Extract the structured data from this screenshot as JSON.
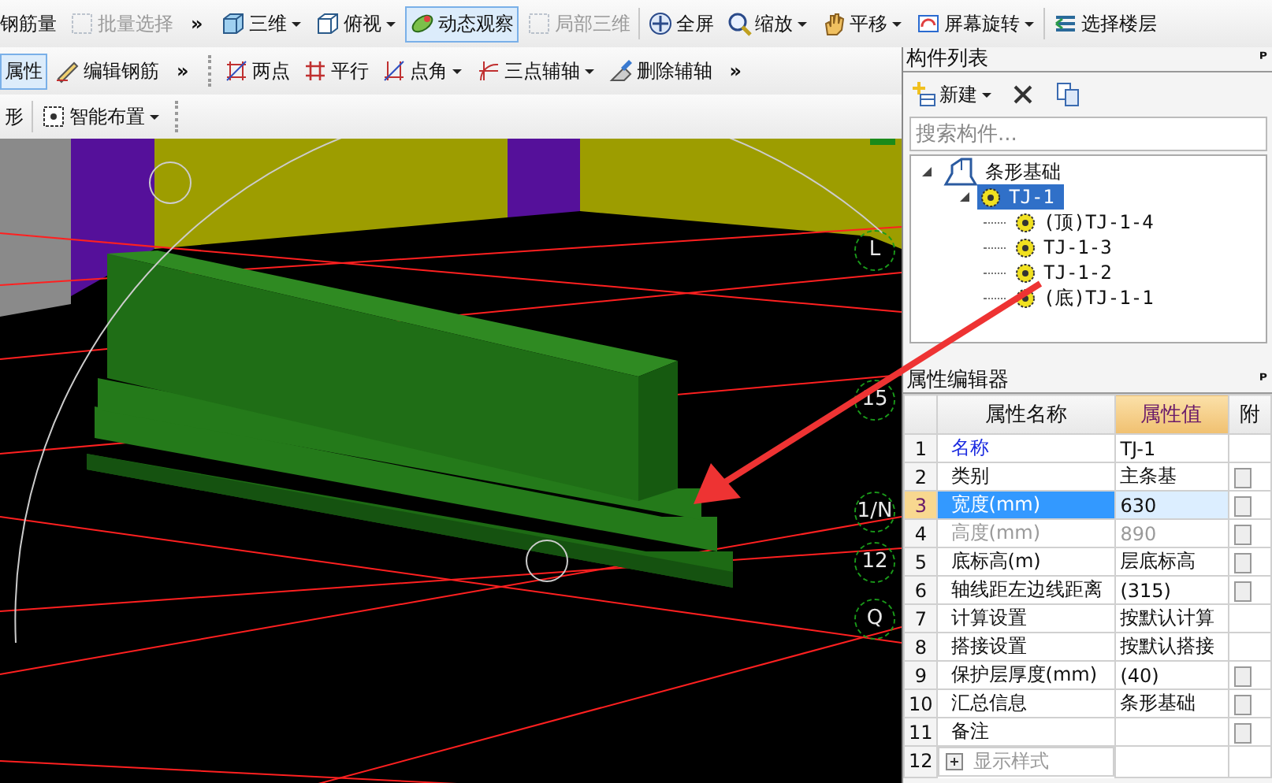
{
  "toolbar_1": [
    {
      "label": "钢筋量",
      "kind": "button",
      "selected": false,
      "disabled": false,
      "dropdown": false
    },
    {
      "label": "批量选择",
      "kind": "button",
      "selected": false,
      "disabled": true,
      "dropdown": false
    },
    {
      "label": "»",
      "kind": "overflow"
    },
    {
      "label": "三维",
      "kind": "button",
      "selected": false,
      "disabled": false,
      "dropdown": true
    },
    {
      "label": "俯视",
      "kind": "button",
      "selected": false,
      "disabled": false,
      "dropdown": true
    },
    {
      "label": "动态观察",
      "kind": "button",
      "selected": true,
      "disabled": false,
      "dropdown": false
    },
    {
      "label": "局部三维",
      "kind": "button",
      "selected": false,
      "disabled": true,
      "dropdown": false
    },
    {
      "kind": "separator"
    },
    {
      "label": "全屏",
      "kind": "button",
      "selected": false,
      "disabled": false,
      "dropdown": false
    },
    {
      "label": "缩放",
      "kind": "button",
      "selected": false,
      "disabled": false,
      "dropdown": true
    },
    {
      "label": "平移",
      "kind": "button",
      "selected": false,
      "disabled": false,
      "dropdown": true
    },
    {
      "label": "屏幕旋转",
      "kind": "button",
      "selected": false,
      "disabled": false,
      "dropdown": true
    },
    {
      "kind": "separator"
    },
    {
      "label": "选择楼层",
      "kind": "button",
      "selected": false,
      "disabled": false,
      "dropdown": false
    }
  ],
  "toolbar_2": [
    {
      "label": "属性",
      "kind": "button",
      "selected": true,
      "disabled": false,
      "dropdown": false
    },
    {
      "label": "编辑钢筋",
      "kind": "button",
      "selected": false,
      "disabled": false,
      "dropdown": false
    },
    {
      "label": "»",
      "kind": "overflow"
    },
    {
      "kind": "handle"
    },
    {
      "label": "两点",
      "kind": "button",
      "selected": false,
      "disabled": false,
      "dropdown": false
    },
    {
      "label": "平行",
      "kind": "button",
      "selected": false,
      "disabled": false,
      "dropdown": false
    },
    {
      "label": "点角",
      "kind": "button",
      "selected": false,
      "disabled": false,
      "dropdown": true
    },
    {
      "label": "三点辅轴",
      "kind": "button",
      "selected": false,
      "disabled": false,
      "dropdown": true
    },
    {
      "label": "删除辅轴",
      "kind": "button",
      "selected": false,
      "disabled": false,
      "dropdown": false
    },
    {
      "label": "»",
      "kind": "overflow"
    }
  ],
  "toolbar_3": [
    {
      "label": "形",
      "kind": "button",
      "selected": false,
      "disabled": false,
      "dropdown": false
    },
    {
      "kind": "separator"
    },
    {
      "label": "智能布置",
      "kind": "button",
      "selected": false,
      "disabled": false,
      "dropdown": true
    },
    {
      "kind": "handle"
    }
  ],
  "viewport": {
    "axis_labels": [
      "L",
      "15",
      "1/N",
      "12",
      "Q"
    ]
  },
  "component_list": {
    "title": "构件列表",
    "pin": "ᴾ",
    "new_button": {
      "label": "新建",
      "dropdown": true
    },
    "search": {
      "placeholder": "搜索构件..."
    },
    "tree": [
      {
        "label": "条形基础",
        "expanded": true,
        "selected": false,
        "children": [
          {
            "label": "TJ-1",
            "expanded": true,
            "selected": true,
            "children": [
              {
                "label": "(顶)TJ-1-4",
                "selected": false
              },
              {
                "label": "TJ-1-3",
                "selected": false
              },
              {
                "label": "TJ-1-2",
                "selected": false
              },
              {
                "label": "(底)TJ-1-1",
                "selected": false
              }
            ]
          }
        ]
      }
    ]
  },
  "property_editor": {
    "title": "属性编辑器",
    "pin": "ᴾ",
    "columns": [
      {
        "label": "属性名称",
        "selected": false
      },
      {
        "label": "属性值",
        "selected": true
      },
      {
        "label": "附",
        "selected": false
      }
    ],
    "rows": [
      {
        "index": "1",
        "name": "名称",
        "value": "TJ-1",
        "kind": "public",
        "selected": false,
        "disabled": false
      },
      {
        "index": "2",
        "name": "类别",
        "value": "主条基",
        "kind": "normal",
        "selected": false,
        "disabled": false,
        "checked": false
      },
      {
        "index": "3",
        "name": "宽度(mm)",
        "value": "630",
        "kind": "normal",
        "selected": true,
        "disabled": false,
        "checked": false
      },
      {
        "index": "4",
        "name": "高度(mm)",
        "value": "890",
        "kind": "normal",
        "selected": false,
        "disabled": true,
        "checked": false
      },
      {
        "index": "5",
        "name": "底标高(m)",
        "value": "层底标高",
        "kind": "normal",
        "selected": false,
        "disabled": false,
        "checked": false
      },
      {
        "index": "6",
        "name": "轴线距左边线距离",
        "value": "(315)",
        "kind": "normal",
        "selected": false,
        "disabled": false,
        "checked": false
      },
      {
        "index": "7",
        "name": "计算设置",
        "value": "按默认计算",
        "kind": "normal",
        "selected": false,
        "disabled": false
      },
      {
        "index": "8",
        "name": "搭接设置",
        "value": "按默认搭接",
        "kind": "normal",
        "selected": false,
        "disabled": false
      },
      {
        "index": "9",
        "name": "保护层厚度(mm)",
        "value": "(40)",
        "kind": "normal",
        "selected": false,
        "disabled": false,
        "checked": false
      },
      {
        "index": "10",
        "name": "汇总信息",
        "value": "条形基础",
        "kind": "normal",
        "selected": false,
        "disabled": false,
        "checked": false
      },
      {
        "index": "11",
        "name": "备注",
        "value": "",
        "kind": "normal",
        "selected": false,
        "disabled": false,
        "checked": false
      },
      {
        "index": "12",
        "name": "显示样式",
        "kind": "group",
        "expanded": false,
        "selected": false,
        "disabled": true
      }
    ]
  }
}
